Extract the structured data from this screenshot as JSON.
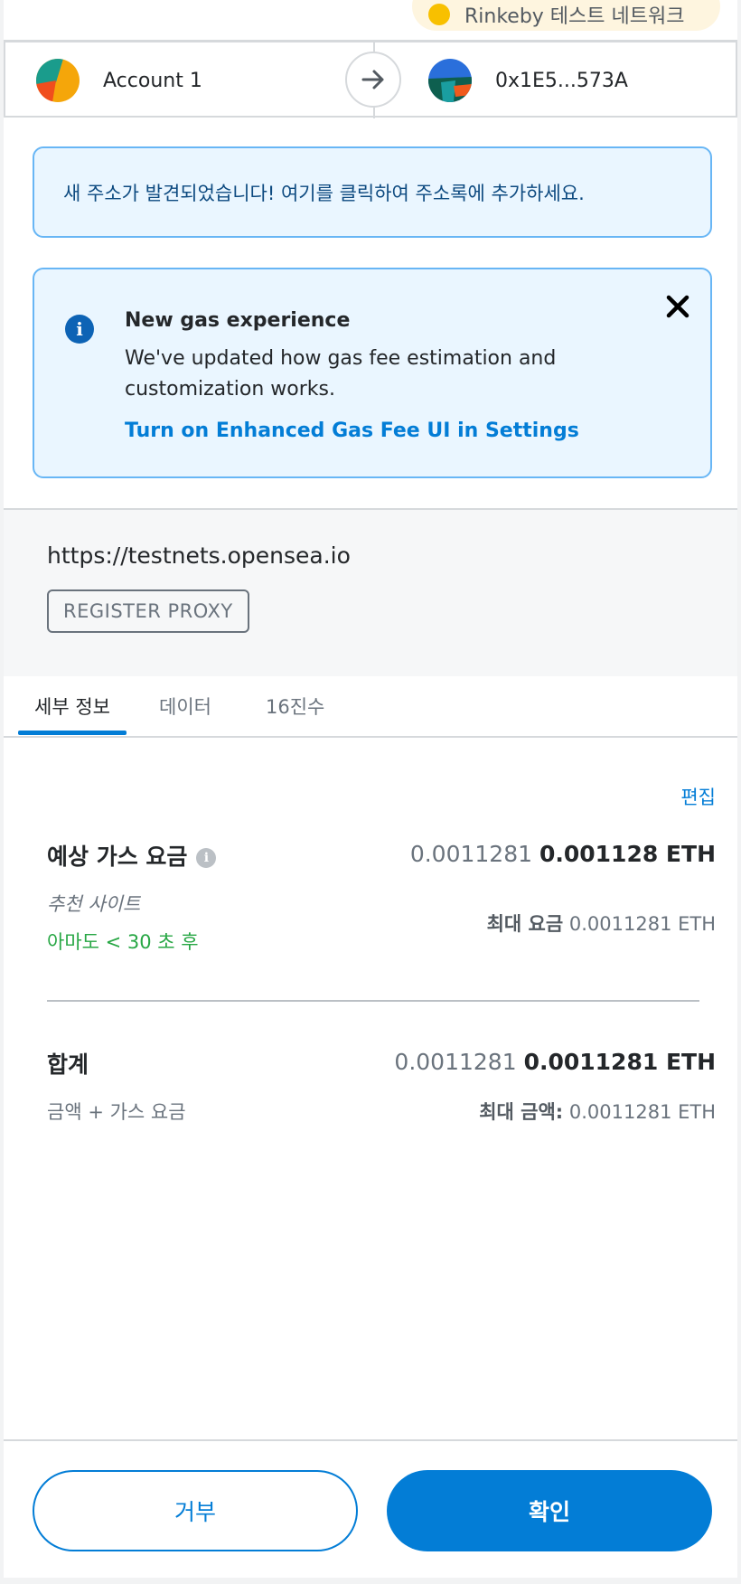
{
  "network": {
    "label": "Rinkeby 테스트 네트워크",
    "dot_color": "#f8c000"
  },
  "sender": {
    "name": "Account 1",
    "avatar_icon": "jazzicon"
  },
  "recipient": {
    "address": "0x1E5...573A",
    "avatar_icon": "jazzicon"
  },
  "arrow_icon": "arrow-right-icon",
  "address_notice": {
    "text": "새 주소가 발견되었습니다! 여기를 클릭하여 주소록에 추가하세요."
  },
  "gas_banner": {
    "title": "New gas experience",
    "body": "We've updated how gas fee estimation and customization works.",
    "link": "Turn on Enhanced Gas Fee UI in Settings"
  },
  "origin": {
    "url": "https://testnets.opensea.io",
    "method": "REGISTER PROXY"
  },
  "tabs": [
    {
      "label": "세부 정보",
      "active": true
    },
    {
      "label": "데이터",
      "active": false
    },
    {
      "label": "16진수",
      "active": false
    }
  ],
  "details": {
    "edit": "편집",
    "gas": {
      "label": "예상 가스 요금",
      "secondary": "0.0011281",
      "primary": "0.001128 ETH",
      "site_suggestion": "추천 사이트",
      "timing": "아마도 < 30 초 후",
      "max_label": "최대 요금",
      "max_value": "0.0011281 ETH"
    },
    "total": {
      "label": "합계",
      "secondary": "0.0011281",
      "primary": "0.0011281 ETH",
      "sub": "금액 + 가스 요금",
      "max_label": "최대 금액:",
      "max_value": "0.0011281 ETH"
    }
  },
  "footer": {
    "reject": "거부",
    "confirm": "확인"
  },
  "colors": {
    "accent": "#037dd6",
    "success": "#28a745",
    "banner_bg": "#eaf6ff",
    "banner_border": "#68b6f5"
  }
}
